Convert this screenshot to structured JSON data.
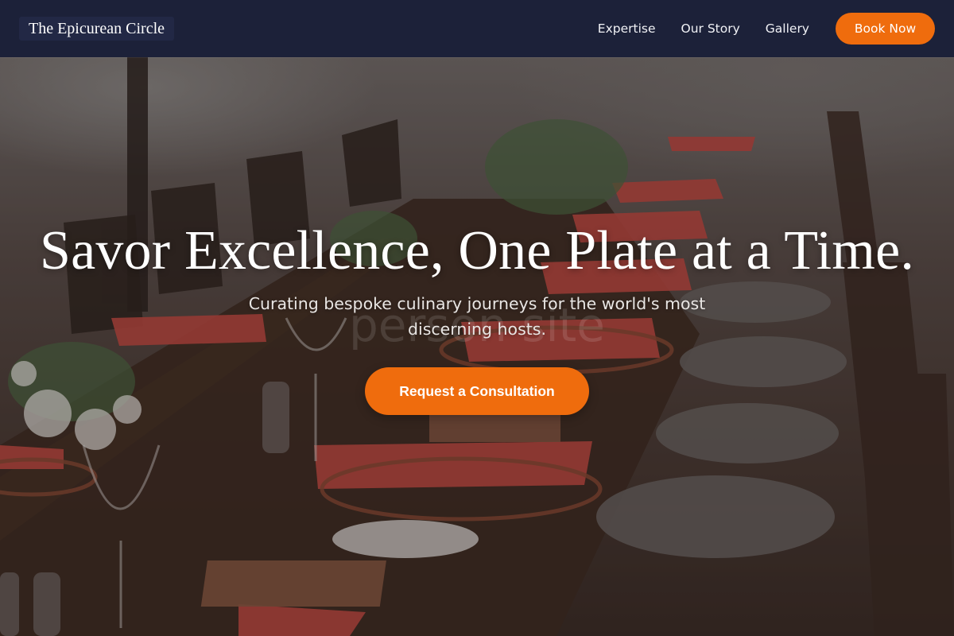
{
  "brand": {
    "name": "The Epicurean Circle"
  },
  "nav": {
    "links": [
      "Expertise",
      "Our Story",
      "Gallery"
    ],
    "cta_label": "Book Now"
  },
  "hero": {
    "title": "Savor Excellence, One Plate at a Time.",
    "subtitle": "Curating bespoke culinary journeys for the world's most discerning hosts.",
    "watermark": "person       site",
    "cta_label": "Request a Consultation",
    "image_alt_icon": "dining-table-photo"
  },
  "colors": {
    "navbar_bg": "#1c2139",
    "accent": "#ef6c0d",
    "text_light": "#ffffff"
  }
}
